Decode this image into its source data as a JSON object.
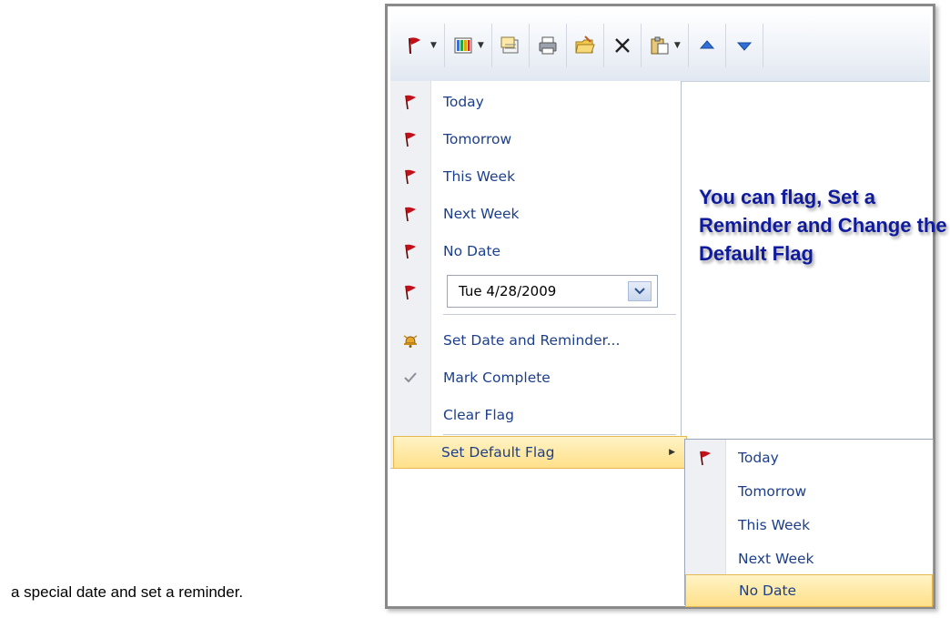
{
  "caption": "a special date  and set a reminder.",
  "toolbar": {
    "icons": [
      "flag-dropdown",
      "categorize-dropdown",
      "address-book",
      "print",
      "move-to-folder",
      "delete",
      "paste-dropdown",
      "move-up",
      "move-down"
    ]
  },
  "flag_menu": {
    "items": [
      "Today",
      "Tomorrow",
      "This Week",
      "Next Week",
      "No Date"
    ],
    "date_value": "Tue 4/28/2009",
    "set_date_reminder": "Set Date and Reminder...",
    "mark_complete": "Mark Complete",
    "clear_flag": "Clear Flag",
    "set_default_flag": "Set Default Flag"
  },
  "default_flag_submenu": {
    "items": [
      "Today",
      "Tomorrow",
      "This Week",
      "Next Week",
      "No Date"
    ],
    "selected": "No Date"
  },
  "callout": "You can flag, Set a Reminder and Change the Default Flag",
  "colors": {
    "menu_text": "#1c3f8c",
    "highlight": "#ffe08a",
    "callout_text": "#0f1b9c",
    "flag": "#c0101a"
  }
}
